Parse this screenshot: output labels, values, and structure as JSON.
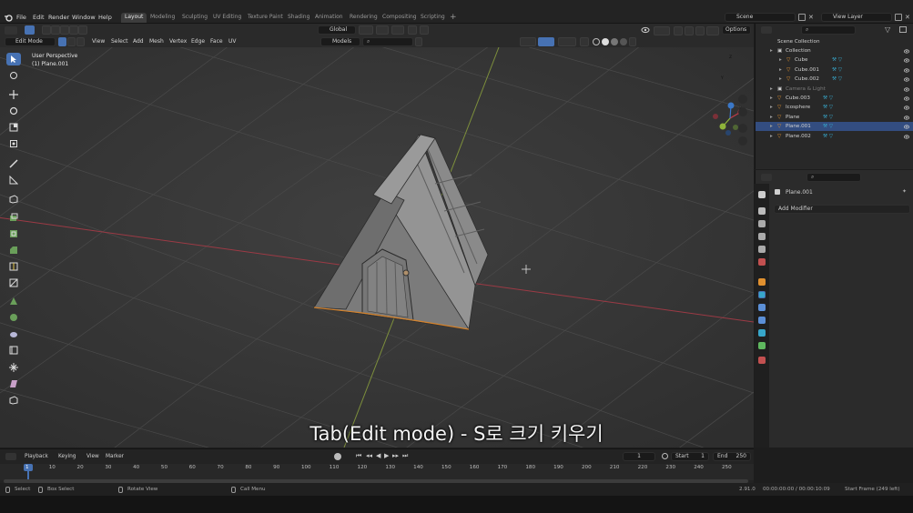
{
  "topbar": {
    "menus": [
      "File",
      "Edit",
      "Render",
      "Window",
      "Help"
    ],
    "workspaces": [
      "Layout",
      "Modeling",
      "Sculpting",
      "UV Editing",
      "Texture Paint",
      "Shading",
      "Animation",
      "Rendering",
      "Compositing",
      "Scripting"
    ],
    "active_workspace": "Layout",
    "scene": "Scene",
    "view_layer": "View Layer"
  },
  "viewport_header": {
    "mode": "Edit Mode",
    "menus": [
      "View",
      "Select",
      "Add",
      "Mesh",
      "Vertex",
      "Edge",
      "Face",
      "UV"
    ],
    "orientation": "Global",
    "snap_target": "Models",
    "options": "Options"
  },
  "viewport": {
    "view_name": "User Perspective",
    "object_name": "(1) Plane.001",
    "subtitle": "Tab(Edit mode) - S로 크기 키우기",
    "gizmo_axes": [
      "X",
      "Y",
      "Z"
    ]
  },
  "outliner": {
    "title": "Scene Collection",
    "rows": [
      {
        "label": "Collection",
        "indent": 1,
        "kind": "collection",
        "selected": false,
        "dim": false
      },
      {
        "label": "Cube",
        "indent": 2,
        "kind": "mesh",
        "selected": false,
        "dim": false
      },
      {
        "label": "Cube.001",
        "indent": 2,
        "kind": "mesh",
        "selected": false,
        "dim": false
      },
      {
        "label": "Cube.002",
        "indent": 2,
        "kind": "mesh",
        "selected": false,
        "dim": false
      },
      {
        "label": "Camera & Light",
        "indent": 1,
        "kind": "collection",
        "selected": false,
        "dim": true
      },
      {
        "label": "Cube.003",
        "indent": 1,
        "kind": "mesh",
        "selected": false,
        "dim": false
      },
      {
        "label": "Icosphere",
        "indent": 1,
        "kind": "mesh",
        "selected": false,
        "dim": false
      },
      {
        "label": "Plane",
        "indent": 1,
        "kind": "mesh",
        "selected": false,
        "dim": false
      },
      {
        "label": "Plane.001",
        "indent": 1,
        "kind": "mesh",
        "selected": true,
        "dim": false
      },
      {
        "label": "Plane.002",
        "indent": 1,
        "kind": "mesh",
        "selected": false,
        "dim": false
      }
    ]
  },
  "properties": {
    "object": "Plane.001",
    "add_modifier": "Add Modifier"
  },
  "timeline": {
    "menus": [
      "Playback",
      "Keying",
      "View",
      "Marker"
    ],
    "current_frame": "1",
    "start_label": "Start",
    "start": "1",
    "end_label": "End",
    "end": "250",
    "ticks": [
      "1",
      "10",
      "20",
      "30",
      "40",
      "50",
      "60",
      "70",
      "80",
      "90",
      "100",
      "110",
      "120",
      "130",
      "140",
      "150",
      "160",
      "170",
      "180",
      "190",
      "200",
      "210",
      "220",
      "230",
      "240",
      "250"
    ]
  },
  "statusbar": {
    "select": "Select",
    "box_select": "Box Select",
    "rotate_view": "Rotate View",
    "call_menu": "Call Menu",
    "version": "2.91.0",
    "time": "00:00:00:00 / 00:00:10:09",
    "start_frame": "Start Frame (249 left)"
  },
  "colors": {
    "accent": "#4772b3",
    "selected_row": "#334d80",
    "x_axis": "#c13b48",
    "y_axis": "#8fb33a",
    "mesh_icon": "#e0902f",
    "modifier_icon": "#37a6c9"
  }
}
